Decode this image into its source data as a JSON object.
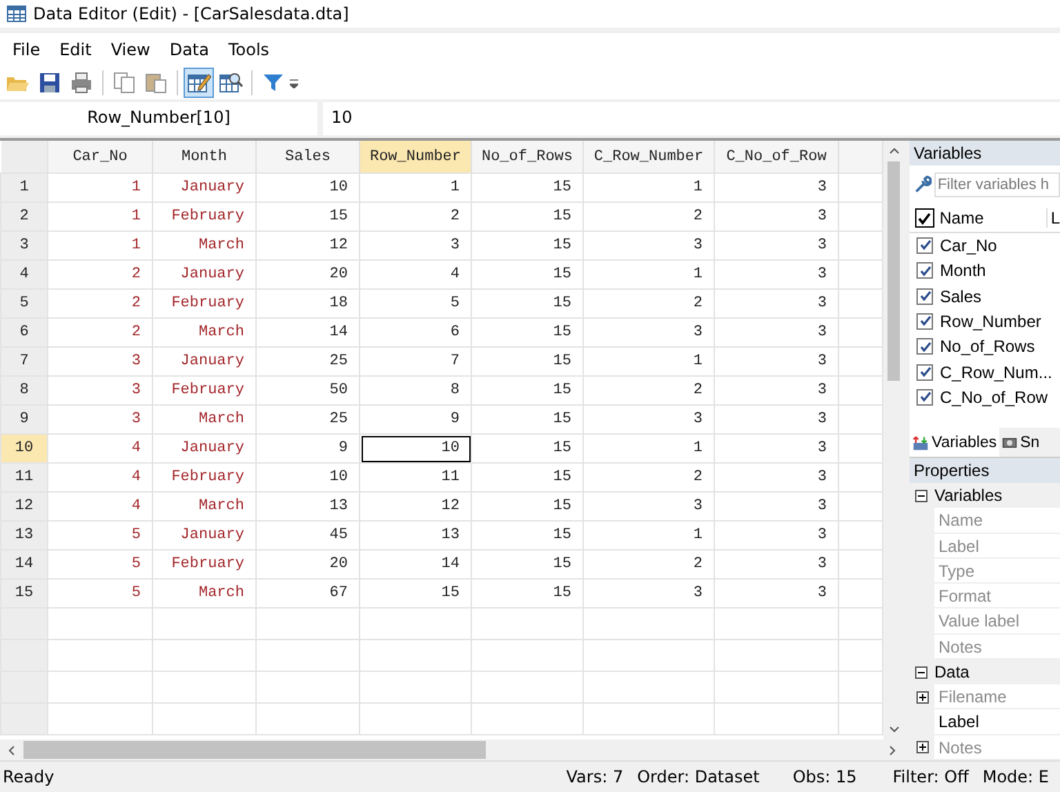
{
  "window": {
    "title": "Data Editor (Edit) - [CarSalesdata.dta]"
  },
  "menu": [
    "File",
    "Edit",
    "View",
    "Data",
    "Tools"
  ],
  "toolbar": [
    {
      "kind": "open",
      "selected": false
    },
    {
      "kind": "save",
      "selected": false
    },
    {
      "kind": "print",
      "selected": false
    },
    {
      "kind": "sep"
    },
    {
      "kind": "copy",
      "selected": false
    },
    {
      "kind": "paste",
      "selected": false
    },
    {
      "kind": "sep"
    },
    {
      "kind": "edit",
      "selected": true
    },
    {
      "kind": "browse",
      "selected": false
    },
    {
      "kind": "sep"
    },
    {
      "kind": "filter",
      "selected": false
    }
  ],
  "cell_bar": {
    "name": "Row_Number[10]",
    "value": "10"
  },
  "table": {
    "columns": [
      {
        "label": "Car_No",
        "labeled": true,
        "selected": false
      },
      {
        "label": "Month",
        "labeled": true,
        "selected": false
      },
      {
        "label": "Sales",
        "labeled": false,
        "selected": false
      },
      {
        "label": "Row_Number",
        "labeled": false,
        "selected": true
      },
      {
        "label": "No_of_Rows",
        "labeled": false,
        "selected": false
      },
      {
        "label": "C_Row_Number",
        "labeled": false,
        "selected": false
      },
      {
        "label": "C_No_of_Row",
        "labeled": false,
        "selected": false
      }
    ],
    "rows": [
      {
        "number": "1",
        "selected": false,
        "cells": [
          "1",
          "January",
          "10",
          "1",
          "15",
          "1",
          "3"
        ]
      },
      {
        "number": "2",
        "selected": false,
        "cells": [
          "1",
          "February",
          "15",
          "2",
          "15",
          "2",
          "3"
        ]
      },
      {
        "number": "3",
        "selected": false,
        "cells": [
          "1",
          "March",
          "12",
          "3",
          "15",
          "3",
          "3"
        ]
      },
      {
        "number": "4",
        "selected": false,
        "cells": [
          "2",
          "January",
          "20",
          "4",
          "15",
          "1",
          "3"
        ]
      },
      {
        "number": "5",
        "selected": false,
        "cells": [
          "2",
          "February",
          "18",
          "5",
          "15",
          "2",
          "3"
        ]
      },
      {
        "number": "6",
        "selected": false,
        "cells": [
          "2",
          "March",
          "14",
          "6",
          "15",
          "3",
          "3"
        ]
      },
      {
        "number": "7",
        "selected": false,
        "cells": [
          "3",
          "January",
          "25",
          "7",
          "15",
          "1",
          "3"
        ]
      },
      {
        "number": "8",
        "selected": false,
        "cells": [
          "3",
          "February",
          "50",
          "8",
          "15",
          "2",
          "3"
        ]
      },
      {
        "number": "9",
        "selected": false,
        "cells": [
          "3",
          "March",
          "25",
          "9",
          "15",
          "3",
          "3"
        ]
      },
      {
        "number": "10",
        "selected": true,
        "cells": [
          "4",
          "January",
          "9",
          "10",
          "15",
          "1",
          "3"
        ]
      },
      {
        "number": "11",
        "selected": false,
        "cells": [
          "4",
          "February",
          "10",
          "11",
          "15",
          "2",
          "3"
        ]
      },
      {
        "number": "12",
        "selected": false,
        "cells": [
          "4",
          "March",
          "13",
          "12",
          "15",
          "3",
          "3"
        ]
      },
      {
        "number": "13",
        "selected": false,
        "cells": [
          "5",
          "January",
          "45",
          "13",
          "15",
          "1",
          "3"
        ]
      },
      {
        "number": "14",
        "selected": false,
        "cells": [
          "5",
          "February",
          "20",
          "14",
          "15",
          "2",
          "3"
        ]
      },
      {
        "number": "15",
        "selected": false,
        "cells": [
          "5",
          "March",
          "67",
          "15",
          "15",
          "3",
          "3"
        ]
      }
    ]
  },
  "variables_panel": {
    "title": "Variables",
    "filter": {
      "placeholder": "Filter variables h"
    },
    "header": {
      "name": "Name",
      "label": "L",
      "checked": true
    },
    "items": [
      {
        "name": "Car_No",
        "checked": true
      },
      {
        "name": "Month",
        "checked": true
      },
      {
        "name": "Sales",
        "checked": true
      },
      {
        "name": "Row_Number",
        "checked": true
      },
      {
        "name": "No_of_Rows",
        "checked": true
      },
      {
        "name": "C_Row_Num...",
        "checked": true
      },
      {
        "name": "C_No_of_Row",
        "checked": true
      }
    ],
    "tabs": [
      {
        "label": "Variables",
        "selected": true
      },
      {
        "label": "Sn",
        "selected": false
      }
    ]
  },
  "properties_panel": {
    "title": "Properties",
    "sections": [
      {
        "label": "Variables",
        "expanded": true,
        "items": [
          {
            "label": "Name",
            "enabled": false
          },
          {
            "label": "Label",
            "enabled": false
          },
          {
            "label": "Type",
            "enabled": false
          },
          {
            "label": "Format",
            "enabled": false
          },
          {
            "label": "Value label",
            "enabled": false
          },
          {
            "label": "Notes",
            "enabled": false
          }
        ]
      },
      {
        "label": "Data",
        "expanded": true,
        "items": [
          {
            "label": "Filename",
            "expanded": false,
            "enabled": false
          },
          {
            "label": "Label",
            "enabled": true
          },
          {
            "label": "Notes",
            "expanded": false,
            "enabled": false
          }
        ]
      }
    ]
  },
  "status_bar": {
    "left": "Ready",
    "vars": "Vars: 7",
    "order": "Order: Dataset",
    "obs": "Obs: 15",
    "filter": "Filter: Off",
    "mode": "Mode: E"
  }
}
